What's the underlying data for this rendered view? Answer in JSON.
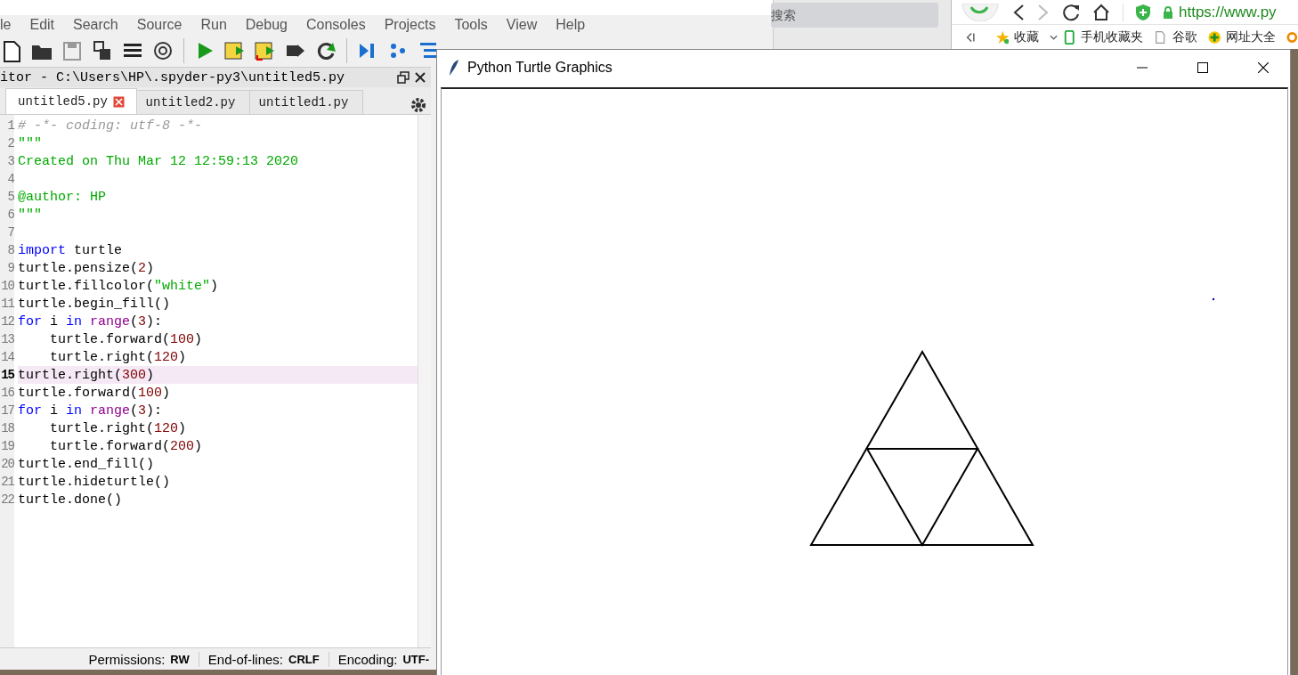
{
  "spyder": {
    "menu": [
      "le",
      "Edit",
      "Search",
      "Source",
      "Run",
      "Debug",
      "Consoles",
      "Projects",
      "Tools",
      "View",
      "Help"
    ],
    "editor_title": "itor - C:\\Users\\HP\\.spyder-py3\\untitled5.py",
    "tabs": [
      {
        "label": "untitled5.py",
        "selected": true
      },
      {
        "label": "untitled2.py",
        "selected": false
      },
      {
        "label": "untitled1.py",
        "selected": false
      }
    ],
    "code": [
      {
        "number": "1",
        "current": false,
        "tokens": [
          {
            "kind": "comment",
            "text": "# -*- coding: utf-8 -*-"
          }
        ]
      },
      {
        "number": "2",
        "current": false,
        "tokens": [
          {
            "kind": "string",
            "text": "\"\"\""
          }
        ]
      },
      {
        "number": "3",
        "current": false,
        "tokens": [
          {
            "kind": "string",
            "text": "Created on Thu Mar 12 12:59:13 2020"
          }
        ]
      },
      {
        "number": "4",
        "current": false
      },
      {
        "number": "5",
        "current": false,
        "tokens": [
          {
            "kind": "string",
            "text": "@author: HP"
          }
        ]
      },
      {
        "number": "6",
        "current": false,
        "tokens": [
          {
            "kind": "string",
            "text": "\"\"\""
          }
        ]
      },
      {
        "number": "7",
        "current": false
      },
      {
        "number": "8",
        "current": false,
        "tokens": [
          {
            "kind": "keyword",
            "text": "import"
          },
          {
            "kind": "plain",
            "text": " turtle"
          }
        ]
      },
      {
        "number": "9",
        "current": false,
        "tokens": [
          {
            "kind": "plain",
            "text": "turtle.pensize("
          },
          {
            "kind": "number",
            "text": "2"
          },
          {
            "kind": "plain",
            "text": ")"
          }
        ]
      },
      {
        "number": "10",
        "current": false,
        "tokens": [
          {
            "kind": "plain",
            "text": "turtle.fillcolor("
          },
          {
            "kind": "string",
            "text": "\"white\""
          },
          {
            "kind": "plain",
            "text": ")"
          }
        ]
      },
      {
        "number": "11",
        "current": false,
        "tokens": [
          {
            "kind": "plain",
            "text": "turtle.begin_fill()"
          }
        ]
      },
      {
        "number": "12",
        "current": false,
        "tokens": [
          {
            "kind": "keyword",
            "text": "for"
          },
          {
            "kind": "plain",
            "text": " i "
          },
          {
            "kind": "keyword",
            "text": "in"
          },
          {
            "kind": "builtin",
            "text": " range"
          },
          {
            "kind": "plain",
            "text": "("
          },
          {
            "kind": "number",
            "text": "3"
          },
          {
            "kind": "plain",
            "text": "):"
          }
        ]
      },
      {
        "number": "13",
        "current": false,
        "tokens": [
          {
            "kind": "plain",
            "text": "    turtle.forward("
          },
          {
            "kind": "number",
            "text": "100"
          },
          {
            "kind": "plain",
            "text": ")"
          }
        ]
      },
      {
        "number": "14",
        "current": false,
        "tokens": [
          {
            "kind": "plain",
            "text": "    turtle.right("
          },
          {
            "kind": "number",
            "text": "120"
          },
          {
            "kind": "plain",
            "text": ")"
          }
        ]
      },
      {
        "number": "15",
        "current": true,
        "tokens": [
          {
            "kind": "plain",
            "text": "turtle.right("
          },
          {
            "kind": "number",
            "text": "300"
          },
          {
            "kind": "plain",
            "text": ")"
          }
        ]
      },
      {
        "number": "16",
        "current": false,
        "tokens": [
          {
            "kind": "plain",
            "text": "turtle.forward("
          },
          {
            "kind": "number",
            "text": "100"
          },
          {
            "kind": "plain",
            "text": ")"
          }
        ]
      },
      {
        "number": "17",
        "current": false,
        "tokens": [
          {
            "kind": "keyword",
            "text": "for"
          },
          {
            "kind": "plain",
            "text": " i "
          },
          {
            "kind": "keyword",
            "text": "in"
          },
          {
            "kind": "builtin",
            "text": " range"
          },
          {
            "kind": "plain",
            "text": "("
          },
          {
            "kind": "number",
            "text": "3"
          },
          {
            "kind": "plain",
            "text": "):"
          }
        ]
      },
      {
        "number": "18",
        "current": false,
        "tokens": [
          {
            "kind": "plain",
            "text": "    turtle.right("
          },
          {
            "kind": "number",
            "text": "120"
          },
          {
            "kind": "plain",
            "text": ")"
          }
        ]
      },
      {
        "number": "19",
        "current": false,
        "tokens": [
          {
            "kind": "plain",
            "text": "    turtle.forward("
          },
          {
            "kind": "number",
            "text": "200"
          },
          {
            "kind": "plain",
            "text": ")"
          }
        ]
      },
      {
        "number": "20",
        "current": false,
        "tokens": [
          {
            "kind": "plain",
            "text": "turtle.end_fill()"
          }
        ]
      },
      {
        "number": "21",
        "current": false,
        "tokens": [
          {
            "kind": "plain",
            "text": "turtle.hideturtle()"
          }
        ]
      },
      {
        "number": "22",
        "current": false,
        "tokens": [
          {
            "kind": "plain",
            "text": "turtle.done()"
          }
        ]
      }
    ],
    "status_bar": [
      {
        "label": "Permissions:",
        "value": "RW"
      },
      {
        "label": "End-of-lines:",
        "value": "CRLF"
      },
      {
        "label": "Encoding:",
        "value": "UTF-"
      }
    ]
  },
  "search_window": {
    "placeholder": "搜索"
  },
  "browser": {
    "url": "https://www.py",
    "bookmarks": [
      {
        "label": "收藏"
      },
      {
        "label": "手机收藏夹"
      },
      {
        "label": "谷歌"
      },
      {
        "label": "网址大全"
      }
    ]
  },
  "turtle_window": {
    "title": "Python Turtle Graphics"
  }
}
